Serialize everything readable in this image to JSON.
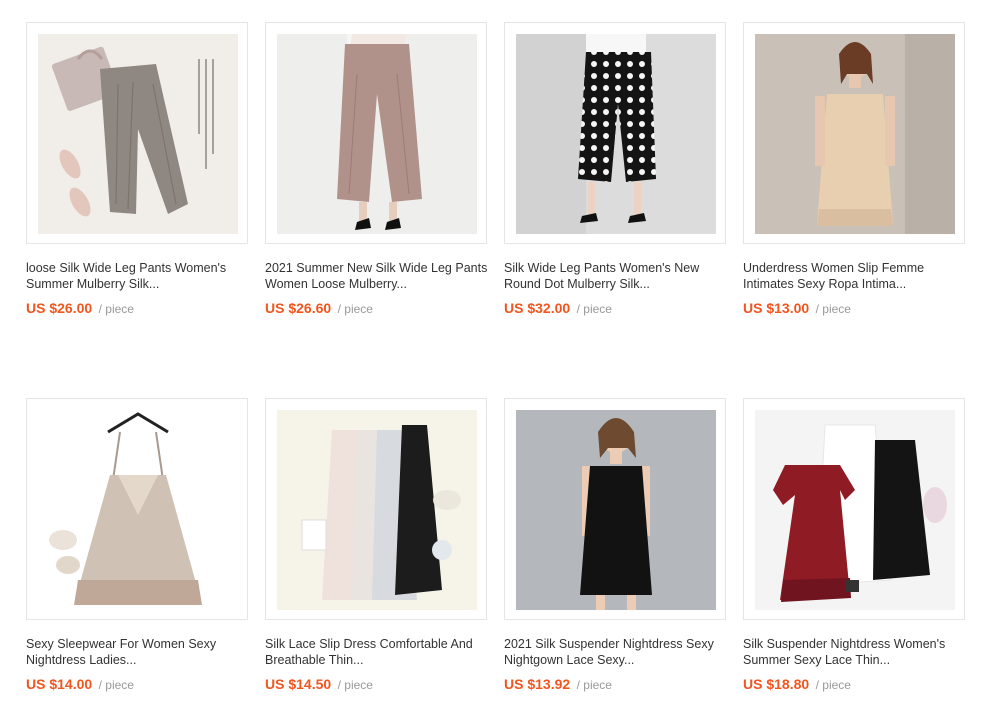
{
  "colors": {
    "price": "#f2551d",
    "title": "#333333",
    "unit": "#999999",
    "border": "#e5e5e5"
  },
  "products": [
    {
      "title": "loose Silk Wide Leg Pants Women's\nSummer Mulberry Silk...",
      "price": "US $26.00",
      "unit": "/ piece",
      "image_icon": "flatlay-pants-image"
    },
    {
      "title": "2021 Summer New Silk Wide Leg Pants\nWomen Loose Mulberry...",
      "price": "US $26.60",
      "unit": "/ piece",
      "image_icon": "model-pants-image"
    },
    {
      "title": "Silk Wide Leg Pants Women's New\nRound Dot Mulberry Silk...",
      "price": "US $32.00",
      "unit": "/ piece",
      "image_icon": "polka-dot-pants-image"
    },
    {
      "title": "Underdress Women Slip Femme\nIntimates Sexy Ropa Intima...",
      "price": "US $13.00",
      "unit": "/ piece",
      "image_icon": "slip-dress-model-image"
    },
    {
      "title": "Sexy Sleepwear For Women Sexy\nNightdress Ladies...",
      "price": "US $14.00",
      "unit": "/ piece",
      "image_icon": "hanging-nightdress-image"
    },
    {
      "title": "Silk Lace Slip Dress Comfortable And\nBreathable Thin...",
      "price": "US $14.50",
      "unit": "/ piece",
      "image_icon": "slip-dresses-flatlay-image"
    },
    {
      "title": "2021 Silk Suspender Nightdress Sexy\nNightgown Lace Sexy...",
      "price": "US $13.92",
      "unit": "/ piece",
      "image_icon": "black-nightgown-model-image"
    },
    {
      "title": "Silk Suspender Nightdress Women's\nSummer Sexy Lace Thin...",
      "price": "US $18.80",
      "unit": "/ piece",
      "image_icon": "nightdress-set-image"
    }
  ]
}
